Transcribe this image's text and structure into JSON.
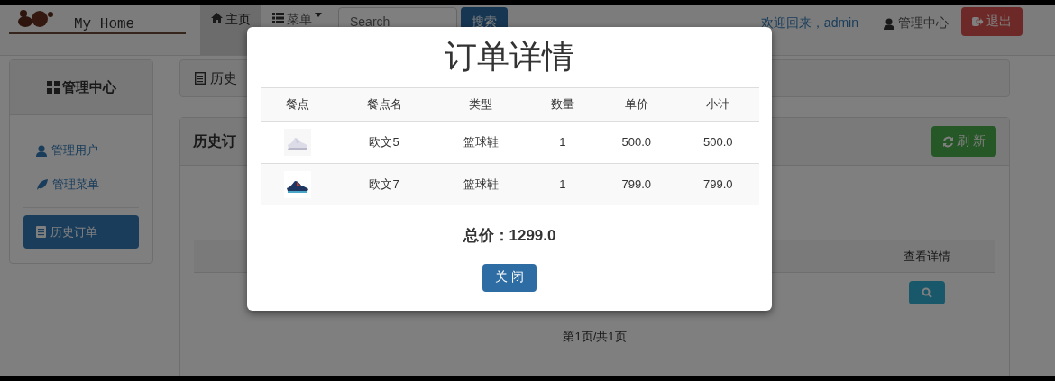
{
  "navbar": {
    "brand": "My Home",
    "nav_items": [
      {
        "label": "主页",
        "selected": true
      },
      {
        "label": "菜单",
        "selected": false
      }
    ],
    "search": {
      "placeholder": "Search",
      "button": "搜索"
    },
    "welcome": "欢迎回来，admin",
    "admin_link": "管理中心",
    "logout": "退出"
  },
  "sidebar": {
    "title": "管理中心",
    "items": [
      {
        "label": "管理用户",
        "selected": false
      },
      {
        "label": "管理菜单",
        "selected": false
      },
      {
        "label": "历史订单",
        "selected": true
      }
    ]
  },
  "breadcrumb": "历史",
  "panel": {
    "title": "历史订",
    "refresh": "刷 新",
    "table_header": "查看详情",
    "pagination": "第1页/共1页"
  },
  "modal": {
    "title": "订单详情",
    "columns": [
      "餐点",
      "餐点名",
      "类型",
      "数量",
      "单价",
      "小计"
    ],
    "rows": [
      {
        "name": "欧文5",
        "type": "篮球鞋",
        "quantity": "1",
        "price": "500.0",
        "subtotal": "500.0"
      },
      {
        "name": "欧文7",
        "type": "篮球鞋",
        "quantity": "1",
        "price": "799.0",
        "subtotal": "799.0"
      }
    ],
    "total": "总价：1299.0",
    "close": "关 闭"
  }
}
